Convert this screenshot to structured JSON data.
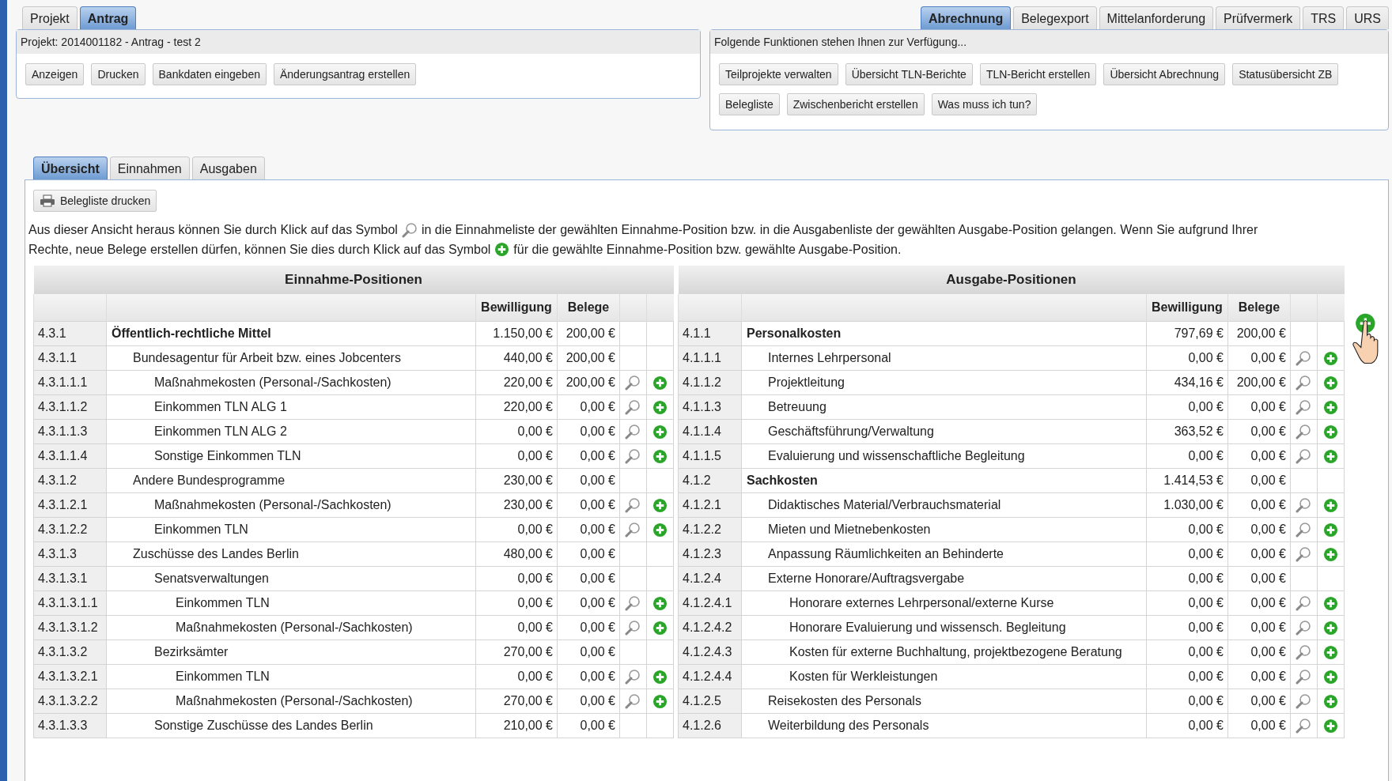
{
  "left_tabs": [
    {
      "label": "Projekt",
      "selected": false
    },
    {
      "label": "Antrag",
      "selected": true
    }
  ],
  "project_panel": {
    "header": "Projekt: 2014001182 - Antrag - test 2",
    "buttons": [
      "Anzeigen",
      "Drucken",
      "Bankdaten eingeben",
      "Änderungsantrag erstellen"
    ]
  },
  "right_tabs": [
    {
      "label": "Abrechnung",
      "selected": true
    },
    {
      "label": "Belegexport",
      "selected": false
    },
    {
      "label": "Mittelanforderung",
      "selected": false
    },
    {
      "label": "Prüfvermerk",
      "selected": false
    },
    {
      "label": "TRS",
      "selected": false
    },
    {
      "label": "URS",
      "selected": false
    }
  ],
  "functions_panel": {
    "header": "Folgende Funktionen stehen Ihnen zur Verfügung...",
    "buttons": [
      "Teilprojekte verwalten",
      "Übersicht TLN-Berichte",
      "TLN-Bericht erstellen",
      "Übersicht Abrechnung",
      "Statusübersicht ZB",
      "Belegliste",
      "Zwischenbericht erstellen",
      "Was muss ich tun?"
    ]
  },
  "view_tabs": [
    {
      "label": "Übersicht",
      "selected": true
    },
    {
      "label": "Einnahmen",
      "selected": false
    },
    {
      "label": "Ausgaben",
      "selected": false
    }
  ],
  "print_button": "Belegliste drucken",
  "info": {
    "text_1": "Aus dieser Ansicht heraus können Sie durch Klick auf das Symbol",
    "text_2": "in die Einnahmeliste der gewählten Einnahme-Position bzw. in die Ausgabenliste der gewählten Ausgabe-Position gelangen. Wenn Sie aufgrund Ihrer",
    "text_3": "Rechte, neue Belege erstellen dürfen, können Sie dies durch Klick auf das Symbol",
    "text_4": "für die gewählte Einnahme-Position bzw. gewählte Ausgabe-Position."
  },
  "income": {
    "title": "Einnahme-Positionen",
    "columns": [
      "Bewilligung",
      "Belege"
    ],
    "rows": [
      {
        "code": "4.3.1",
        "name": "Öffentlich-rechtliche Mittel",
        "approved": "1.150,00 €",
        "receipts": "200,00 €",
        "actions": false,
        "children": [
          {
            "code": "4.3.1.1",
            "name": "Bundesagentur für Arbeit bzw. eines Jobcenters",
            "approved": "440,00 €",
            "receipts": "200,00 €",
            "actions": false,
            "children": [
              {
                "code": "4.3.1.1.1",
                "name": "Maßnahmekosten (Personal-/Sachkosten)",
                "approved": "220,00 €",
                "receipts": "200,00 €",
                "actions": true
              },
              {
                "code": "4.3.1.1.2",
                "name": "Einkommen TLN ALG 1",
                "approved": "220,00 €",
                "receipts": "0,00 €",
                "actions": true
              },
              {
                "code": "4.3.1.1.3",
                "name": "Einkommen TLN ALG 2",
                "approved": "0,00 €",
                "receipts": "0,00 €",
                "actions": true
              },
              {
                "code": "4.3.1.1.4",
                "name": "Sonstige Einkommen TLN",
                "approved": "0,00 €",
                "receipts": "0,00 €",
                "actions": true
              }
            ]
          },
          {
            "code": "4.3.1.2",
            "name": "Andere Bundesprogramme",
            "approved": "230,00 €",
            "receipts": "0,00 €",
            "actions": false,
            "children": [
              {
                "code": "4.3.1.2.1",
                "name": "Maßnahmekosten (Personal-/Sachkosten)",
                "approved": "230,00 €",
                "receipts": "0,00 €",
                "actions": true
              },
              {
                "code": "4.3.1.2.2",
                "name": "Einkommen TLN",
                "approved": "0,00 €",
                "receipts": "0,00 €",
                "actions": true
              }
            ]
          },
          {
            "code": "4.3.1.3",
            "name": "Zuschüsse des Landes Berlin",
            "approved": "480,00 €",
            "receipts": "0,00 €",
            "actions": false,
            "children": [
              {
                "code": "4.3.1.3.1",
                "name": "Senatsverwaltungen",
                "approved": "0,00 €",
                "receipts": "0,00 €",
                "actions": false,
                "children": [
                  {
                    "code": "4.3.1.3.1.1",
                    "name": "Einkommen TLN",
                    "approved": "0,00 €",
                    "receipts": "0,00 €",
                    "actions": true
                  },
                  {
                    "code": "4.3.1.3.1.2",
                    "name": "Maßnahmekosten (Personal-/Sachkosten)",
                    "approved": "0,00 €",
                    "receipts": "0,00 €",
                    "actions": true
                  }
                ]
              },
              {
                "code": "4.3.1.3.2",
                "name": "Bezirksämter",
                "approved": "270,00 €",
                "receipts": "0,00 €",
                "actions": false,
                "children": [
                  {
                    "code": "4.3.1.3.2.1",
                    "name": "Einkommen TLN",
                    "approved": "0,00 €",
                    "receipts": "0,00 €",
                    "actions": true
                  },
                  {
                    "code": "4.3.1.3.2.2",
                    "name": "Maßnahmekosten (Personal-/Sachkosten)",
                    "approved": "270,00 €",
                    "receipts": "0,00 €",
                    "actions": true
                  }
                ]
              },
              {
                "code": "4.3.1.3.3",
                "name": "Sonstige Zuschüsse des Landes Berlin",
                "approved": "210,00 €",
                "receipts": "0,00 €",
                "actions": false
              }
            ]
          }
        ]
      }
    ]
  },
  "expenses": {
    "title": "Ausgabe-Positionen",
    "columns": [
      "Bewilligung",
      "Belege"
    ],
    "rows": [
      {
        "code": "4.1.1",
        "name": "Personalkosten",
        "approved": "797,69 €",
        "receipts": "200,00 €",
        "actions": false,
        "children": [
          {
            "code": "4.1.1.1",
            "name": "Internes Lehrpersonal",
            "approved": "0,00 €",
            "receipts": "0,00 €",
            "actions": true
          },
          {
            "code": "4.1.1.2",
            "name": "Projektleitung",
            "approved": "434,16 €",
            "receipts": "200,00 €",
            "actions": true
          },
          {
            "code": "4.1.1.3",
            "name": "Betreuung",
            "approved": "0,00 €",
            "receipts": "0,00 €",
            "actions": true
          },
          {
            "code": "4.1.1.4",
            "name": "Geschäftsführung/Verwaltung",
            "approved": "363,52 €",
            "receipts": "0,00 €",
            "actions": true
          },
          {
            "code": "4.1.1.5",
            "name": "Evaluierung und wissenschaftliche Begleitung",
            "approved": "0,00 €",
            "receipts": "0,00 €",
            "actions": true
          }
        ]
      },
      {
        "code": "4.1.2",
        "name": "Sachkosten",
        "approved": "1.414,53 €",
        "receipts": "0,00 €",
        "actions": false,
        "children": [
          {
            "code": "4.1.2.1",
            "name": "Didaktisches Material/Verbrauchsmaterial",
            "approved": "1.030,00 €",
            "receipts": "0,00 €",
            "actions": true
          },
          {
            "code": "4.1.2.2",
            "name": "Mieten und Mietnebenkosten",
            "approved": "0,00 €",
            "receipts": "0,00 €",
            "actions": true
          },
          {
            "code": "4.1.2.3",
            "name": "Anpassung Räumlichkeiten an Behinderte",
            "approved": "0,00 €",
            "receipts": "0,00 €",
            "actions": true
          },
          {
            "code": "4.1.2.4",
            "name": "Externe Honorare/Auftragsvergabe",
            "approved": "0,00 €",
            "receipts": "0,00 €",
            "actions": false,
            "children": [
              {
                "code": "4.1.2.4.1",
                "name": "Honorare externes Lehrpersonal/externe Kurse",
                "approved": "0,00 €",
                "receipts": "0,00 €",
                "actions": true
              },
              {
                "code": "4.1.2.4.2",
                "name": "Honorare Evaluierung und wissensch. Begleitung",
                "approved": "0,00 €",
                "receipts": "0,00 €",
                "actions": true
              },
              {
                "code": "4.1.2.4.3",
                "name": "Kosten für externe Buchhaltung, projektbezogene Beratung",
                "approved": "0,00 €",
                "receipts": "0,00 €",
                "actions": true
              },
              {
                "code": "4.1.2.4.4",
                "name": "Kosten für Werkleistungen",
                "approved": "0,00 €",
                "receipts": "0,00 €",
                "actions": true
              }
            ]
          },
          {
            "code": "4.1.2.5",
            "name": "Reisekosten des Personals",
            "approved": "0,00 €",
            "receipts": "0,00 €",
            "actions": true
          },
          {
            "code": "4.1.2.6",
            "name": "Weiterbildung des Personals",
            "approved": "0,00 €",
            "receipts": "0,00 €",
            "actions": true
          }
        ]
      }
    ]
  }
}
